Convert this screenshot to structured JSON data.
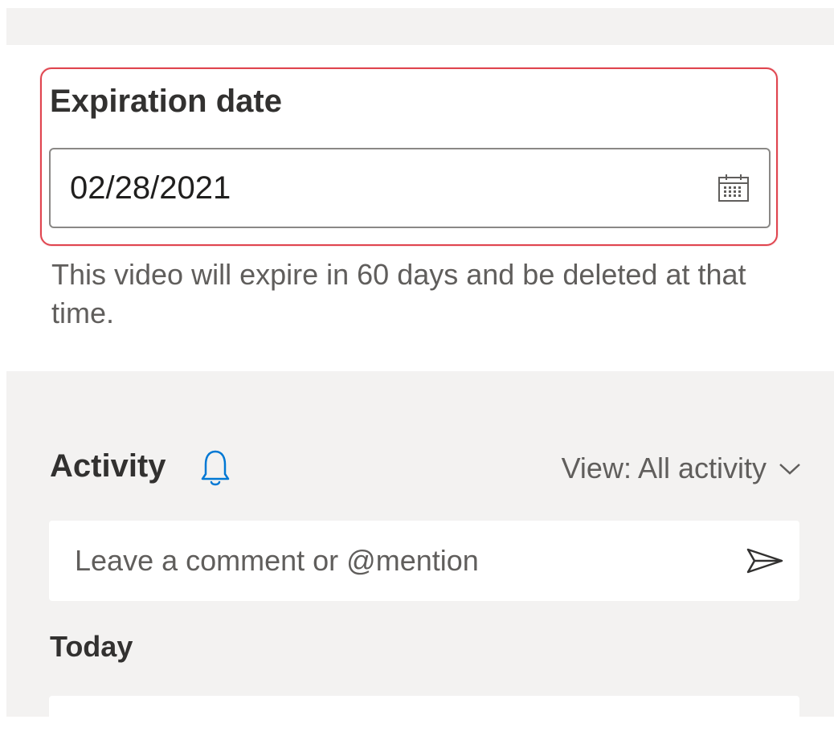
{
  "expiration": {
    "label": "Expiration date",
    "date_value": "02/28/2021",
    "calendar_icon": "calendar-icon",
    "help_text": "This video will expire in 60 days and be deleted at that time."
  },
  "activity": {
    "title": "Activity",
    "bell_icon": "bell-icon",
    "view_filter_label": "View: All activity",
    "comment_placeholder": "Leave a comment or @mention",
    "send_icon": "send-icon",
    "today_label": "Today"
  },
  "colors": {
    "highlight": "#e0454f",
    "accent": "#0078d4",
    "panel_bg": "#f3f2f1"
  }
}
